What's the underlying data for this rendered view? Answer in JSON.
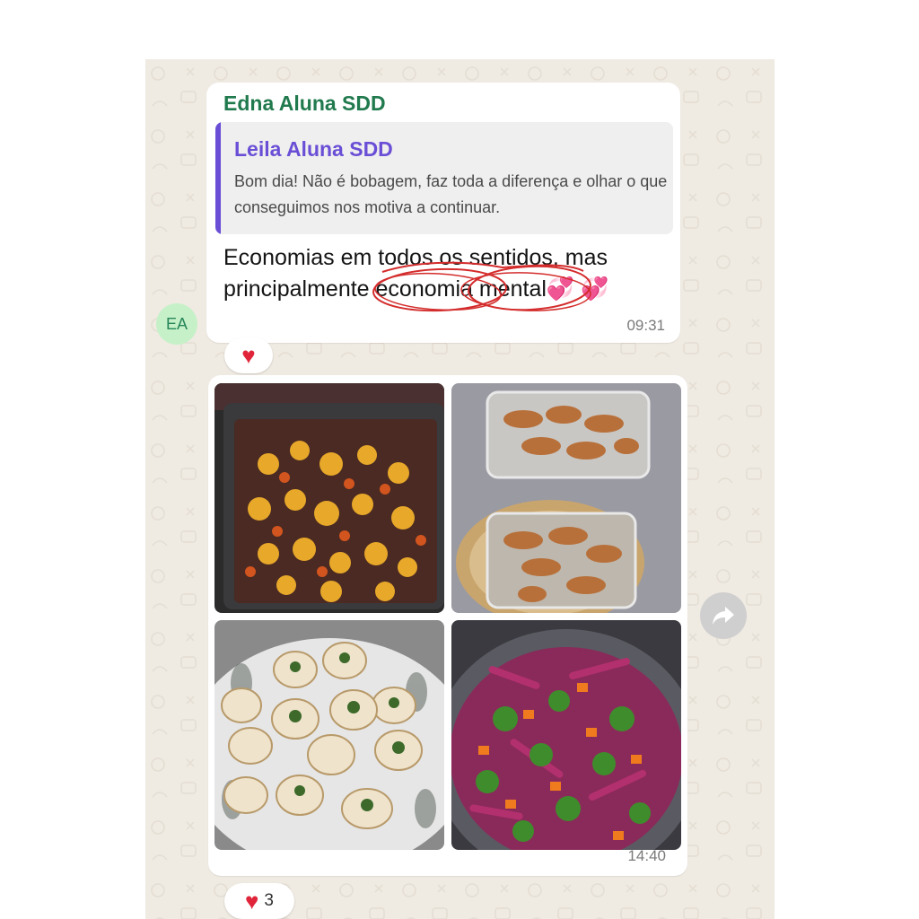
{
  "chat": {
    "avatar_initials": "EA",
    "message": {
      "sender": "Edna Aluna SDD",
      "quote_author": "Leila Aluna SDD",
      "quote_text": "Bom dia! Não é bobagem, faz toda a diferença e olhar o que conseguimos nos motiva a continuar.",
      "text_line1": "Economias em todos os sentidos, mas",
      "text_line2": "principalmente economia mental",
      "emoji": "💞 💞",
      "time": "09:31",
      "reaction_emoji": "heart"
    },
    "photos_message": {
      "photo_1": "tray of roasted chicken with carrots",
      "photo_2": "glass containers with grilled chicken strips",
      "photo_3": "plate of stuffed chicken rolls",
      "photo_4": "pan of stir-fried vegetables with broccoli and red cabbage",
      "time": "14:40",
      "reaction_count": "3"
    },
    "icons": {
      "forward": "forward-arrow-icon",
      "reaction": "red-heart-icon"
    },
    "colors": {
      "sender": "#217a4e",
      "quote_author": "#6a4fd6",
      "chat_background": "#efeae2",
      "annotation": "#d42c2c"
    }
  }
}
